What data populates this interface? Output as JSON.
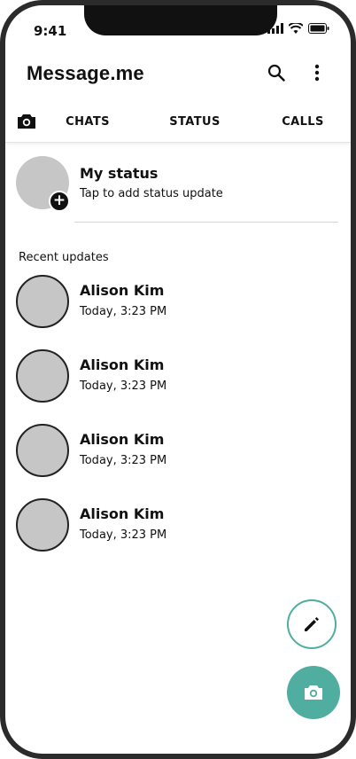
{
  "status_bar": {
    "time": "9:41"
  },
  "app_bar": {
    "title": "Message.me",
    "search_icon": "search-icon",
    "menu_icon": "more-vert-icon"
  },
  "tabs": {
    "camera_icon": "camera-icon",
    "items": [
      {
        "label": "CHATS"
      },
      {
        "label": "STATUS"
      },
      {
        "label": "CALLS"
      }
    ]
  },
  "my_status": {
    "title": "My status",
    "subtitle": "Tap to add status update",
    "badge": "+"
  },
  "recent": {
    "heading": "Recent updates",
    "items": [
      {
        "name": "Alison Kim",
        "time": "Today, 3:23 PM"
      },
      {
        "name": "Alison Kim",
        "time": "Today, 3:23 PM"
      },
      {
        "name": "Alison Kim",
        "time": "Today, 3:23 PM"
      },
      {
        "name": "Alison Kim",
        "time": "Today, 3:23 PM"
      }
    ]
  },
  "fabs": {
    "edit_icon": "pencil-icon",
    "camera_icon": "camera-icon"
  },
  "colors": {
    "accent": "#4fae9f",
    "avatar": "#c6c6c6",
    "text": "#111111"
  }
}
